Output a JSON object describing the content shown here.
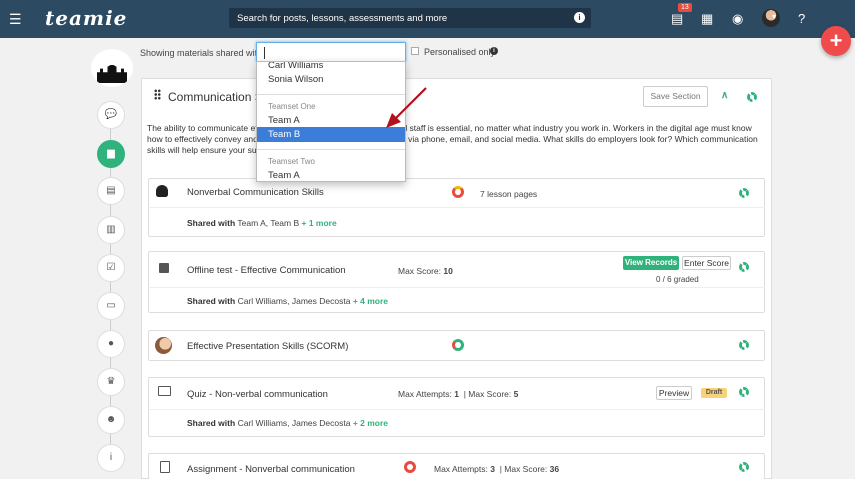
{
  "topbar": {
    "brand": "teamie",
    "search_placeholder": "Search for posts, lessons, assessments and more",
    "notification_count": "13"
  },
  "filter": {
    "label": "Showing materials shared with",
    "personalised_label": "Personalised only"
  },
  "dropdown": {
    "items": [
      {
        "label": "Carl Williams"
      },
      {
        "label": "Sonia Wilson"
      }
    ],
    "groups": [
      {
        "name": "Teamset One",
        "items": [
          "Team A",
          "Team B"
        ]
      },
      {
        "name": "Teamset Two",
        "items": [
          "Team A"
        ]
      }
    ],
    "highlighted": "Team B"
  },
  "section": {
    "title": "Communication Skills",
    "save_label": "Save Section",
    "description": "The ability to communicate effectively with superiors, colleagues, and staff is essential, no matter what industry you work in. Workers in the digital age must know how to effectively convey and receive messages in person as well as via phone, email, and social media. What skills do employers look for? Which communication skills will help ensure your success?"
  },
  "materials": [
    {
      "title": "Nonverbal Communication Skills",
      "meta": "7 lesson pages",
      "shared_prefix": "Shared with",
      "shared_names": "Team A, Team B",
      "shared_more": "+ 1 more"
    },
    {
      "title": "Offline test - Effective Communication",
      "meta_label": "Max Score:",
      "meta_value": "10",
      "shared_prefix": "Shared with",
      "shared_names": "Carl Williams, James Decosta",
      "shared_more": "+ 4 more",
      "view_records": "View Records",
      "enter_score": "Enter Score",
      "graded": "0 / 6 graded"
    },
    {
      "title": "Effective Presentation Skills (SCORM)"
    },
    {
      "title": "Quiz - Non-verbal communication",
      "attempts_label": "Max Attempts:",
      "attempts_value": "1",
      "score_label": "Max Score:",
      "score_value": "5",
      "shared_prefix": "Shared with",
      "shared_names": "Carl Williams, James Decosta",
      "shared_more": "+ 2 more",
      "preview": "Preview",
      "status": "Draft"
    },
    {
      "title": "Assignment - Nonverbal communication",
      "attempts_label": "Max Attempts:",
      "attempts_value": "3",
      "score_label": "Max Score:",
      "score_value": "36"
    }
  ],
  "colors": {
    "accent": "#2fb27c",
    "topbar": "#2d4a63",
    "highlight": "#3b7dd8",
    "fab": "#ef4b4b",
    "arrow": "#b2111e"
  }
}
